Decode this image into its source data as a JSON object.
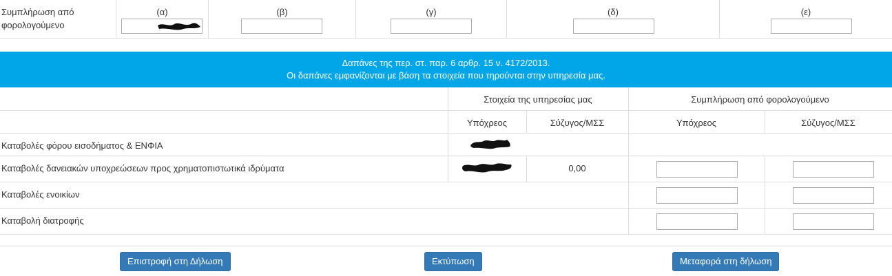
{
  "top": {
    "label": "Συμπλήρωση από φορολογούμενο",
    "columns": [
      "(α)",
      "(β)",
      "(γ)",
      "(δ)",
      "(ε)"
    ]
  },
  "banner": {
    "line1": "Δαπάνες της περ. στ. παρ. 6 αρθρ. 15 ν. 4172/2013.",
    "line2": "Οι δαπάνες εμφανίζονται με βάση τα στοιχεία που τηρούνται στην υπηρεσία μας."
  },
  "table": {
    "group_service": "Στοιχεία της υπηρεσίας μας",
    "group_taxpayer": "Συμπλήρωση από φορολογούμενο",
    "col_obligor": "Υπόχρεος",
    "col_spouse": "Σύζυγος/ΜΣΣ",
    "rows": [
      {
        "label": "Καταβολές φόρου εισοδήματος & ΕΝΦΙΑ",
        "spouse_value": ""
      },
      {
        "label": "Καταβολές δανειακών υποχρεώσεων προς χρηματοπιστωτικά ιδρύματα",
        "spouse_value": "0,00"
      },
      {
        "label": "Καταβολές ενοικίων",
        "spouse_value": ""
      },
      {
        "label": "Καταβολή διατροφής",
        "spouse_value": ""
      }
    ]
  },
  "buttons": {
    "back": "Επιστροφή στη Δήλωση",
    "print": "Εκτύπωση",
    "transfer": "Μεταφορά στη δήλωση"
  },
  "colors": {
    "banner": "#00a6e8",
    "button": "#337ab7"
  }
}
